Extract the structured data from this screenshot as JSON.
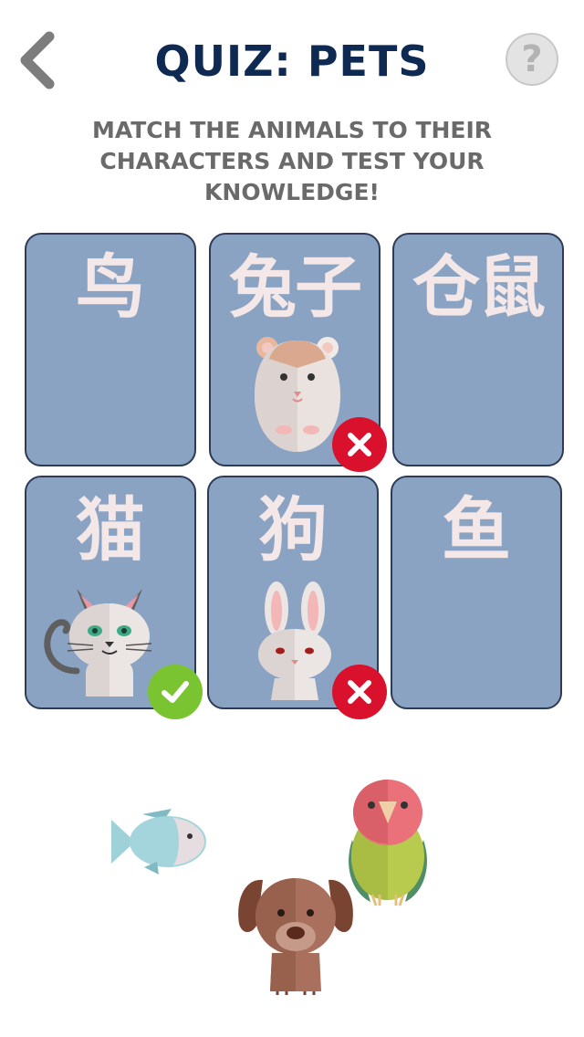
{
  "header": {
    "title": "QUIZ: PETS",
    "help_label": "?"
  },
  "instructions": "MATCH THE ANIMALS TO THEIR CHARACTERS AND TEST YOUR KNOWLEDGE!",
  "cards": [
    {
      "char": "鸟",
      "placed": null,
      "result": null
    },
    {
      "char": "兔子",
      "placed": "hamster",
      "result": "wrong"
    },
    {
      "char": "仓鼠",
      "placed": null,
      "result": null
    },
    {
      "char": "猫",
      "placed": "cat",
      "result": "correct"
    },
    {
      "char": "狗",
      "placed": "rabbit",
      "result": "wrong"
    },
    {
      "char": "鱼",
      "placed": null,
      "result": null
    }
  ],
  "remaining_animals": [
    "fish",
    "parrot",
    "dog"
  ],
  "colors": {
    "title": "#0f2a52",
    "card_bg": "#8ba3c3",
    "card_border": "#2d3b57",
    "wrong": "#d9112c",
    "correct": "#7ac431"
  }
}
